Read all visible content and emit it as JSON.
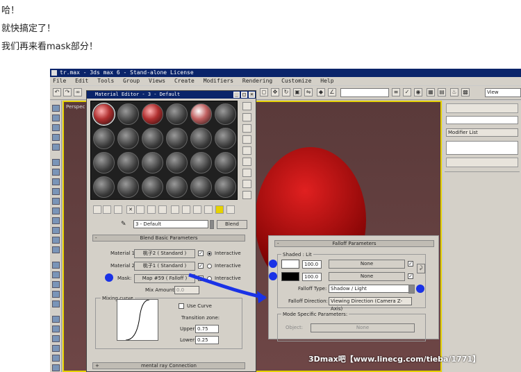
{
  "post": {
    "line1": "哈！",
    "line2": "就快搞定了！",
    "line3": "我们再来看mask部分！"
  },
  "app": {
    "window_title": "tr.max - 3ds max 6 - Stand-alone License",
    "menu": [
      "File",
      "Edit",
      "Tools",
      "Group",
      "Views",
      "Create",
      "Modifiers",
      "Rendering",
      "Customize",
      "Help"
    ],
    "view_select": "View",
    "viewport_label": "Perspec",
    "modifier_list": "Modifier List"
  },
  "material_editor": {
    "title": "Material Editor - 3 - Default",
    "name_value": "3 - Default",
    "type_button": "Blend",
    "rollout_blend": "Blend Basic Parameters",
    "material1_label": "Material 1:",
    "material1_button": "桃子2  ( Standard )",
    "material2_label": "Material 2:",
    "material2_button": "桃子1  ( Standard )",
    "mask_label": "Mask:",
    "mask_button": "Map #59  ( Falloff )",
    "interactive_label": "Interactive",
    "mix_amount_label": "Mix Amount:",
    "mix_amount_value": "0.0",
    "mixing_curve_label": "Mixing curve",
    "use_curve_label": "Use Curve",
    "transition_zone_label": "Transition zone:",
    "upper_label": "Upper:",
    "upper_value": "0.75",
    "lower_label": "Lower:",
    "lower_value": "0.25",
    "rollout_mental": "mental ray Connection",
    "plus": "+",
    "minus": "-"
  },
  "falloff": {
    "title": "Falloff Parameters",
    "shaded_lit_label": "Shaded : Lit",
    "value1": "100.0",
    "value2": "100.0",
    "none1": "None",
    "none2": "None",
    "falloff_type_label": "Falloff Type:",
    "falloff_type_value": "Shadow / Light",
    "falloff_direction_label": "Falloff Direction:",
    "falloff_direction_value": "Viewing Direction (Camera Z-Axis)",
    "mode_specific_label": "Mode Specific Parameters:",
    "object_label": "Object:",
    "object_value": "None",
    "minus": "-"
  },
  "watermark": "3Dmax吧【www.linecg.com/tieba/1771】",
  "colors": {
    "annotation_blue": "#1a32e6",
    "viewport_border": "#e6d200"
  }
}
